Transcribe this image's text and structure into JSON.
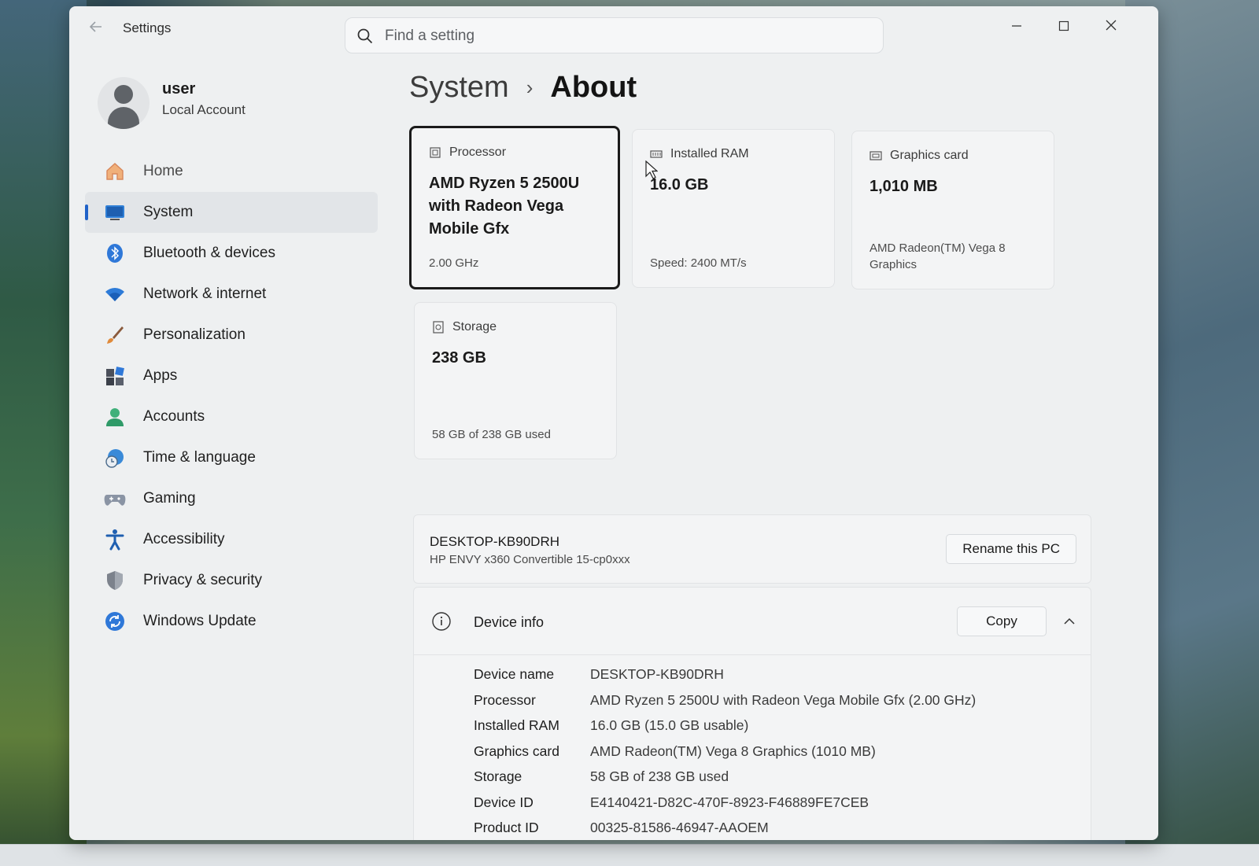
{
  "window": {
    "app_title": "Settings",
    "search_placeholder": "Find a setting"
  },
  "user": {
    "name": "user",
    "account_type": "Local Account"
  },
  "sidebar": {
    "items": [
      {
        "label": "Home",
        "icon": "home-icon"
      },
      {
        "label": "System",
        "icon": "system-icon",
        "active": true
      },
      {
        "label": "Bluetooth & devices",
        "icon": "bluetooth-icon"
      },
      {
        "label": "Network & internet",
        "icon": "wifi-icon"
      },
      {
        "label": "Personalization",
        "icon": "brush-icon"
      },
      {
        "label": "Apps",
        "icon": "apps-icon"
      },
      {
        "label": "Accounts",
        "icon": "person-icon"
      },
      {
        "label": "Time & language",
        "icon": "globe-clock-icon"
      },
      {
        "label": "Gaming",
        "icon": "gamepad-icon"
      },
      {
        "label": "Accessibility",
        "icon": "accessibility-icon"
      },
      {
        "label": "Privacy & security",
        "icon": "shield-icon"
      },
      {
        "label": "Windows Update",
        "icon": "update-icon"
      }
    ],
    "accent_color": "#2062c8"
  },
  "breadcrumb": {
    "parent": "System",
    "separator": "›",
    "current": "About"
  },
  "spec_cards": {
    "processor": {
      "label": "Processor",
      "value": "AMD Ryzen 5 2500U with Radeon Vega Mobile Gfx",
      "detail": "2.00 GHz"
    },
    "ram": {
      "label": "Installed RAM",
      "value": "16.0 GB",
      "detail": "Speed: 2400 MT/s"
    },
    "graphics": {
      "label": "Graphics card",
      "value": "1,010 MB",
      "detail": "AMD Radeon(TM) Vega 8 Graphics"
    },
    "storage": {
      "label": "Storage",
      "value": "238 GB",
      "detail": "58 GB of 238 GB used"
    }
  },
  "pc": {
    "name": "DESKTOP-KB90DRH",
    "model": "HP ENVY x360 Convertible 15-cp0xxx",
    "rename_label": "Rename this PC"
  },
  "device_info": {
    "title": "Device info",
    "copy_label": "Copy",
    "rows": [
      {
        "key": "Device name",
        "value": "DESKTOP-KB90DRH"
      },
      {
        "key": "Processor",
        "value": "AMD Ryzen 5 2500U with Radeon Vega Mobile Gfx (2.00 GHz)"
      },
      {
        "key": "Installed RAM",
        "value": "16.0 GB (15.0 GB usable)"
      },
      {
        "key": "Graphics card",
        "value": "AMD Radeon(TM) Vega 8 Graphics (1010 MB)"
      },
      {
        "key": "Storage",
        "value": "58 GB of 238 GB used"
      },
      {
        "key": "Device ID",
        "value": "E4140421-D82C-470F-8923-F46889FE7CEB"
      },
      {
        "key": "Product ID",
        "value": "00325-81586-46947-AAOEM"
      }
    ]
  }
}
